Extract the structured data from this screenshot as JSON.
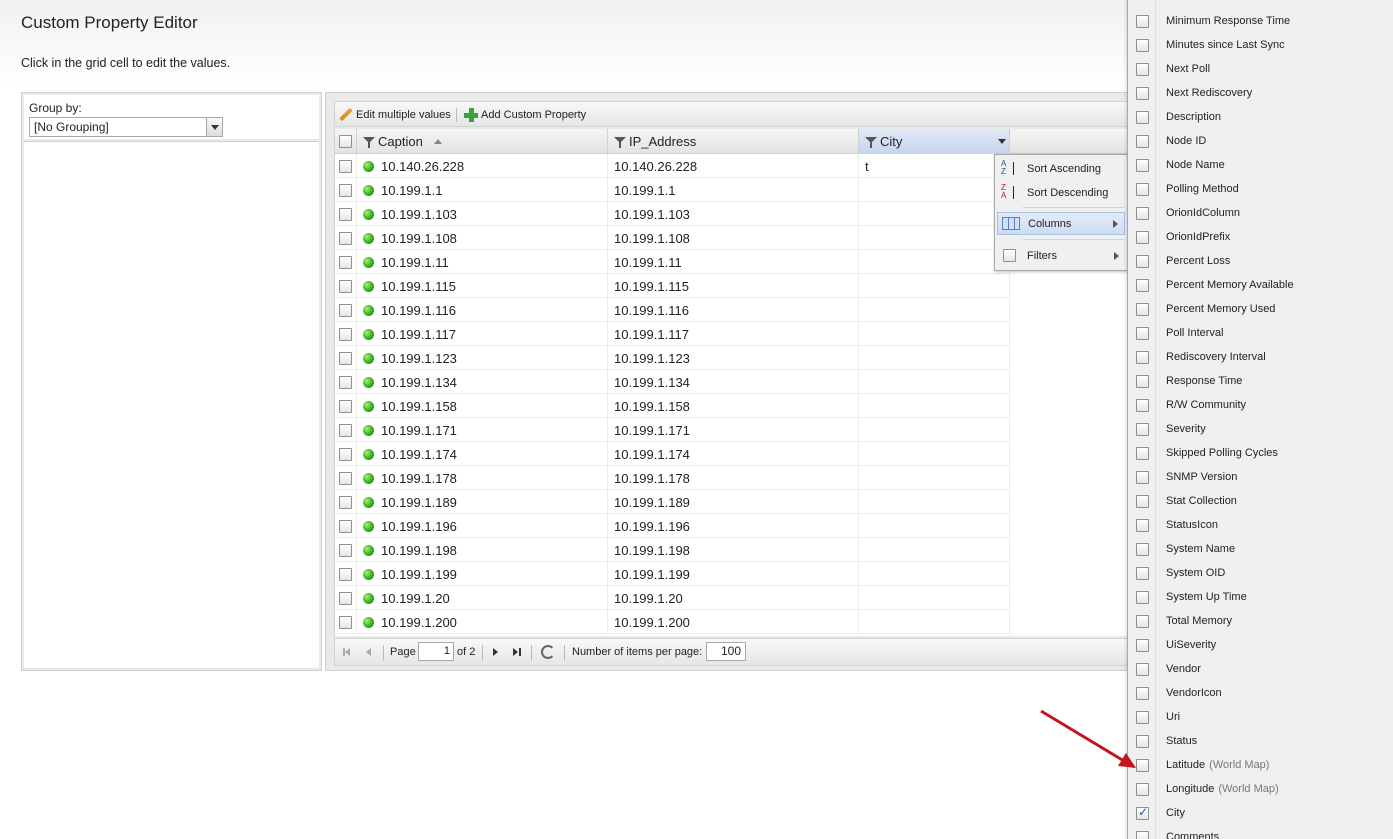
{
  "page": {
    "title": "Custom Property Editor",
    "subtitle": "Click in the grid cell to edit the values."
  },
  "group_by": {
    "label": "Group by:",
    "selected": "[No Grouping]"
  },
  "toolbar": {
    "edit_multiple": "Edit multiple values",
    "add_custom_property": "Add Custom Property"
  },
  "grid": {
    "columns": [
      "Caption",
      "IP_Address",
      "City"
    ],
    "rows": [
      {
        "caption": "10.140.26.228",
        "ip": "10.140.26.228",
        "city": "t"
      },
      {
        "caption": "10.199.1.1",
        "ip": "10.199.1.1",
        "city": ""
      },
      {
        "caption": "10.199.1.103",
        "ip": "10.199.1.103",
        "city": ""
      },
      {
        "caption": "10.199.1.108",
        "ip": "10.199.1.108",
        "city": ""
      },
      {
        "caption": "10.199.1.11",
        "ip": "10.199.1.11",
        "city": ""
      },
      {
        "caption": "10.199.1.115",
        "ip": "10.199.1.115",
        "city": ""
      },
      {
        "caption": "10.199.1.116",
        "ip": "10.199.1.116",
        "city": ""
      },
      {
        "caption": "10.199.1.117",
        "ip": "10.199.1.117",
        "city": ""
      },
      {
        "caption": "10.199.1.123",
        "ip": "10.199.1.123",
        "city": ""
      },
      {
        "caption": "10.199.1.134",
        "ip": "10.199.1.134",
        "city": ""
      },
      {
        "caption": "10.199.1.158",
        "ip": "10.199.1.158",
        "city": ""
      },
      {
        "caption": "10.199.1.171",
        "ip": "10.199.1.171",
        "city": ""
      },
      {
        "caption": "10.199.1.174",
        "ip": "10.199.1.174",
        "city": ""
      },
      {
        "caption": "10.199.1.178",
        "ip": "10.199.1.178",
        "city": ""
      },
      {
        "caption": "10.199.1.189",
        "ip": "10.199.1.189",
        "city": ""
      },
      {
        "caption": "10.199.1.196",
        "ip": "10.199.1.196",
        "city": ""
      },
      {
        "caption": "10.199.1.198",
        "ip": "10.199.1.198",
        "city": ""
      },
      {
        "caption": "10.199.1.199",
        "ip": "10.199.1.199",
        "city": ""
      },
      {
        "caption": "10.199.1.20",
        "ip": "10.199.1.20",
        "city": ""
      },
      {
        "caption": "10.199.1.200",
        "ip": "10.199.1.200",
        "city": ""
      }
    ]
  },
  "pager": {
    "page_label": "Page",
    "current_page": "1",
    "of_label": "of 2",
    "items_per_page_label": "Number of items per page:",
    "items_per_page": "100"
  },
  "column_menu": {
    "sort_ascending": "Sort Ascending",
    "sort_descending": "Sort Descending",
    "columns": "Columns",
    "filters": "Filters"
  },
  "columns_submenu": {
    "items": [
      {
        "label": "Minimum Response Time",
        "checked": false
      },
      {
        "label": "Minutes since Last Sync",
        "checked": false
      },
      {
        "label": "Next Poll",
        "checked": false
      },
      {
        "label": "Next Rediscovery",
        "checked": false
      },
      {
        "label": "Description",
        "checked": false
      },
      {
        "label": "Node ID",
        "checked": false
      },
      {
        "label": "Node Name",
        "checked": false
      },
      {
        "label": "Polling Method",
        "checked": false
      },
      {
        "label": "OrionIdColumn",
        "checked": false
      },
      {
        "label": "OrionIdPrefix",
        "checked": false
      },
      {
        "label": "Percent Loss",
        "checked": false
      },
      {
        "label": "Percent Memory Available",
        "checked": false
      },
      {
        "label": "Percent Memory Used",
        "checked": false
      },
      {
        "label": "Poll Interval",
        "checked": false
      },
      {
        "label": "Rediscovery Interval",
        "checked": false
      },
      {
        "label": "Response Time",
        "checked": false
      },
      {
        "label": "R/W Community",
        "checked": false
      },
      {
        "label": "Severity",
        "checked": false
      },
      {
        "label": "Skipped Polling Cycles",
        "checked": false
      },
      {
        "label": "SNMP Version",
        "checked": false
      },
      {
        "label": "Stat Collection",
        "checked": false
      },
      {
        "label": "StatusIcon",
        "checked": false
      },
      {
        "label": "System Name",
        "checked": false
      },
      {
        "label": "System OID",
        "checked": false
      },
      {
        "label": "System Up Time",
        "checked": false
      },
      {
        "label": "Total Memory",
        "checked": false
      },
      {
        "label": "UiSeverity",
        "checked": false
      },
      {
        "label": "Vendor",
        "checked": false
      },
      {
        "label": "VendorIcon",
        "checked": false
      },
      {
        "label": "Uri",
        "checked": false
      },
      {
        "label": "Status",
        "checked": false
      },
      {
        "label": "Latitude",
        "suffix": "(World Map)",
        "checked": false
      },
      {
        "label": "Longitude",
        "suffix": "(World Map)",
        "checked": false
      },
      {
        "label": "City",
        "checked": true
      },
      {
        "label": "Comments",
        "checked": false
      }
    ]
  },
  "colors": {
    "status_up": "#2fa81a",
    "annotation_arrow": "#c0161c",
    "checkmark": "#2356a8"
  }
}
